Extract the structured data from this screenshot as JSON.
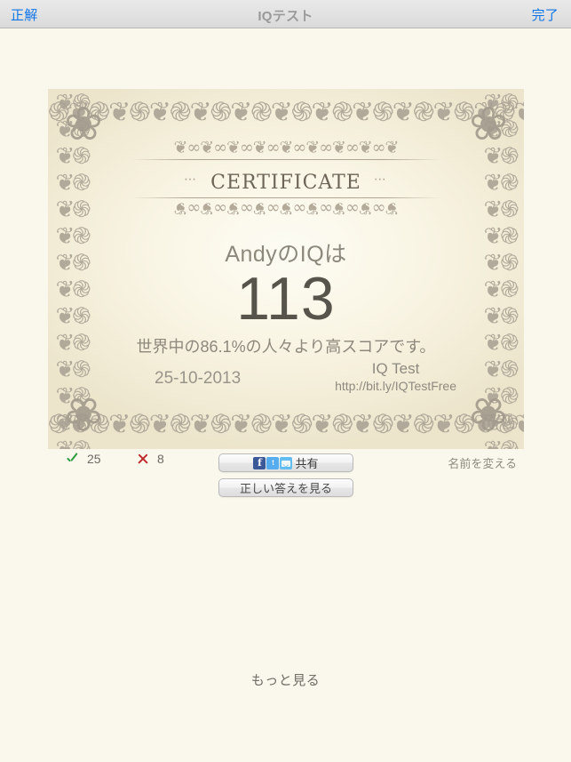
{
  "navbar": {
    "left_button": "正解",
    "title": "IQテスト",
    "right_button": "完了"
  },
  "certificate": {
    "heading": "Certificate",
    "dots_left": "⋯",
    "dots_right": "⋯",
    "flourish_top": "❦∞❦∞❦∞❦∞❦∞❦∞❦∞❦∞❦",
    "flourish_bottom": "❦∞❦∞❦∞❦∞❦∞❦∞❦∞❦∞❦",
    "iq_line": "AndyのIQは",
    "score": "113",
    "rank_line": "世界中の86.1%の人々より高スコアです。",
    "date": "25-10-2013",
    "brand_name": "IQ Test",
    "brand_url": "http://bit.ly/IQTestFree",
    "border_pattern": "֍❦֎❦֍❦֎❦֍❦֎❦֍❦֎❦֍❦֎❦֍❦֎❦֍❦֎❦֍❦֎❦֍❦֎❦֍❦֎❦",
    "border_pattern_side": "❦֍❦֎❦֍❦֎❦֍❦֎❦֍❦֎❦֍❦֎❦֍❦֎❦֍❦֎❦֍❦",
    "corner_ornament": "❀"
  },
  "stats": {
    "correct_count": "25",
    "wrong_count": "8",
    "rename_label": "名前を変える"
  },
  "actions": {
    "share_label": "共有",
    "share_facebook": "f",
    "share_twitter": "t",
    "share_email": "",
    "view_answers_label": "正しい答えを見る"
  },
  "footer": {
    "more_label": "もっと見る"
  },
  "colors": {
    "nav_tint": "#1076e8",
    "nav_title": "#9a9a9a",
    "page_bg": "#faf8ec",
    "score_color": "#57544b",
    "correct_green": "#2f9b3f",
    "wrong_red": "#be2a2d",
    "facebook_blue": "#3b5998",
    "twitter_blue": "#55acee",
    "mail_blue": "#62bdf0"
  }
}
